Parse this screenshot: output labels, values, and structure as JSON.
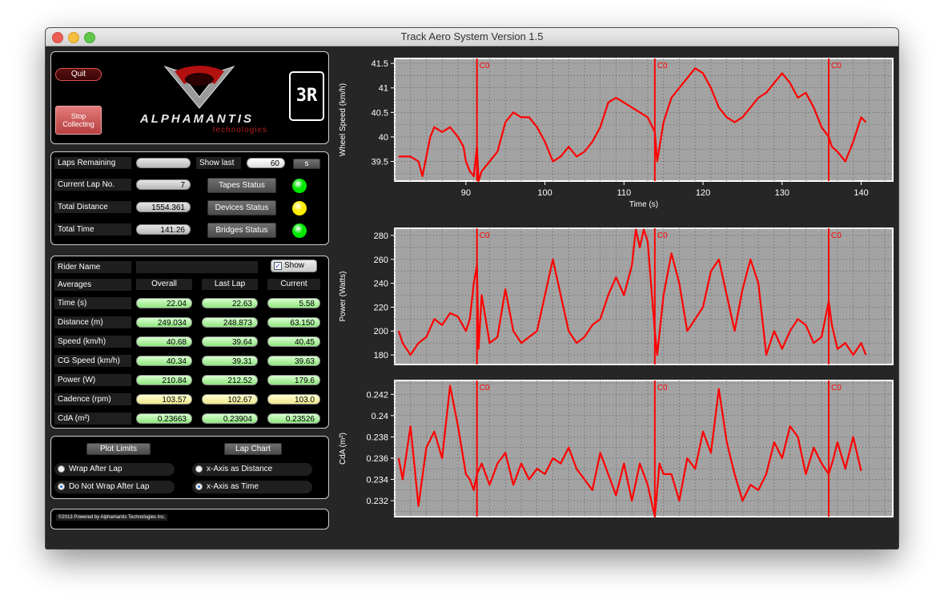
{
  "window": {
    "title": "Track Aero System Version 1.5"
  },
  "header": {
    "quit_label": "Quit",
    "stop_label_1": "Stop",
    "stop_label_2": "Collecting",
    "logo_text": "ALPHAMANTIS",
    "logo_sub": "technologies",
    "track_badge": "3R"
  },
  "status": {
    "laps_remaining_label": "Laps Remaining",
    "laps_remaining_value": "",
    "show_last_label": "Show last",
    "show_last_value": "60",
    "show_last_unit": "s",
    "current_lap_label": "Current Lap No.",
    "current_lap_value": "7",
    "total_distance_label": "Total Distance",
    "total_distance_value": "1554.361",
    "total_time_label": "Total Time",
    "total_time_value": "141.26",
    "tapes_label": "Tapes Status",
    "devices_label": "Devices Status",
    "bridges_label": "Bridges Status",
    "tapes_color": "#00e600",
    "devices_color": "#ffee00",
    "bridges_color": "#00e600"
  },
  "rider": {
    "rider_name_label": "Rider Name",
    "show_label": "Show",
    "averages_label": "Averages",
    "columns": [
      "Overall",
      "Last Lap",
      "Current"
    ],
    "rows": [
      {
        "label": "Time (s)",
        "values": [
          "22.04",
          "22.63",
          "5.58"
        ],
        "style": "green"
      },
      {
        "label": "Distance (m)",
        "values": [
          "249.034",
          "248.873",
          "63.150"
        ],
        "style": "green"
      },
      {
        "label": "Speed (km/h)",
        "values": [
          "40.68",
          "39.64",
          "40.45"
        ],
        "style": "green"
      },
      {
        "label": "CG Speed (km/h)",
        "values": [
          "40.34",
          "39.31",
          "39.63"
        ],
        "style": "green"
      },
      {
        "label": "Power (W)",
        "values": [
          "210.84",
          "212.52",
          "179.6"
        ],
        "style": "green"
      },
      {
        "label": "Cadence (rpm)",
        "values": [
          "103.57",
          "102.67",
          "103.0"
        ],
        "style": "yellow"
      },
      {
        "label": "CdA (m²)",
        "values": [
          "0.23663",
          "0.23904",
          "0.23526"
        ],
        "style": "green"
      }
    ]
  },
  "options": {
    "plot_limits_label": "Plot Limits",
    "lap_chart_label": "Lap Chart",
    "wrap_after_lap": "Wrap After Lap",
    "no_wrap_after_lap": "Do Not Wrap After Lap",
    "x_distance": "x-Axis as Distance",
    "x_time": "x-Axis as Time"
  },
  "footer": {
    "text": "©2013 Powered by Alphamantis Technologies Inc."
  },
  "chart_data": [
    {
      "type": "line",
      "ylabel": "Wheel Speed (km/h)",
      "xlabel": "Time (s)",
      "xlim": [
        81,
        144
      ],
      "ylim": [
        39.1,
        41.6
      ],
      "xticks": [
        90,
        100,
        110,
        120,
        130,
        140
      ],
      "yticks": [
        39.5,
        40,
        40.5,
        41,
        41.5
      ],
      "ytick_labels": [
        "39.5",
        "40",
        "40.5",
        "41",
        "41.5"
      ],
      "marker_label": "C0",
      "markers": [
        91.4,
        113.9,
        135.9
      ],
      "series": [
        {
          "color": "#ff0000",
          "x": [
            81.5,
            83,
            84,
            84.5,
            85.5,
            86,
            87,
            88,
            89,
            89.7,
            90,
            90.5,
            91,
            91.4,
            91.6,
            92,
            93,
            94,
            95,
            96,
            97,
            98,
            99,
            100,
            101,
            102,
            103,
            104,
            105,
            106,
            107,
            108,
            109,
            110,
            111,
            112,
            113,
            113.9,
            114.2,
            115,
            116,
            117,
            118,
            119,
            120,
            121,
            122,
            123,
            124,
            125,
            126,
            127,
            128,
            129,
            130,
            131,
            132,
            133,
            134,
            135,
            135.9,
            136.3,
            137,
            138,
            139,
            140,
            140.6
          ],
          "y": [
            39.6,
            39.6,
            39.5,
            39.2,
            40.0,
            40.2,
            40.1,
            40.2,
            40.0,
            39.8,
            39.5,
            39.3,
            39.2,
            39.8,
            39.1,
            39.3,
            39.5,
            39.7,
            40.3,
            40.5,
            40.4,
            40.4,
            40.2,
            39.9,
            39.5,
            39.6,
            39.8,
            39.6,
            39.7,
            39.9,
            40.2,
            40.7,
            40.8,
            40.7,
            40.6,
            40.5,
            40.4,
            40.1,
            39.5,
            40.3,
            40.8,
            41.0,
            41.2,
            41.4,
            41.3,
            41.0,
            40.6,
            40.4,
            40.3,
            40.4,
            40.6,
            40.8,
            40.9,
            41.1,
            41.3,
            41.1,
            40.8,
            40.9,
            40.6,
            40.2,
            40.0,
            39.8,
            39.7,
            39.5,
            39.9,
            40.4,
            40.3
          ]
        }
      ]
    },
    {
      "type": "line",
      "ylabel": "Power (Watts)",
      "xlabel": "",
      "xlim": [
        81,
        144
      ],
      "ylim": [
        172,
        286
      ],
      "xticks": [],
      "yticks": [
        180,
        200,
        220,
        240,
        260,
        280
      ],
      "ytick_labels": [
        "180",
        "200",
        "220",
        "240",
        "260",
        "280"
      ],
      "marker_label": "C0",
      "markers": [
        91.4,
        113.9,
        135.9
      ],
      "series": [
        {
          "color": "#ff0000",
          "x": [
            81.5,
            82,
            83,
            84,
            85,
            86,
            87,
            88,
            89,
            90,
            90.5,
            91,
            91.4,
            91.6,
            92,
            93,
            94,
            95,
            96,
            97,
            98,
            99,
            100,
            101,
            102,
            103,
            104,
            105,
            106,
            107,
            108,
            109,
            110,
            111,
            111.5,
            112,
            112.5,
            113,
            113.9,
            114.2,
            115,
            116,
            117,
            118,
            119,
            120,
            121,
            122,
            123,
            124,
            125,
            126,
            127,
            128,
            129,
            130,
            131,
            132,
            133,
            134,
            135,
            135.9,
            136.3,
            137,
            138,
            139,
            140,
            140.6
          ],
          "y": [
            200,
            190,
            180,
            190,
            195,
            210,
            205,
            215,
            212,
            200,
            210,
            240,
            255,
            185,
            230,
            190,
            195,
            235,
            200,
            190,
            195,
            200,
            230,
            260,
            230,
            200,
            190,
            195,
            205,
            210,
            230,
            245,
            230,
            255,
            285,
            270,
            285,
            275,
            200,
            180,
            230,
            265,
            240,
            200,
            210,
            220,
            250,
            260,
            230,
            200,
            235,
            260,
            240,
            180,
            200,
            185,
            200,
            210,
            205,
            190,
            195,
            225,
            205,
            185,
            190,
            180,
            190,
            180
          ]
        }
      ]
    },
    {
      "type": "line",
      "ylabel": "CdA (m²)",
      "xlabel": "",
      "xlim": [
        81,
        144
      ],
      "ylim": [
        0.2305,
        0.2433
      ],
      "xticks": [],
      "yticks": [
        0.232,
        0.234,
        0.236,
        0.238,
        0.24,
        0.242
      ],
      "ytick_labels": [
        "0.232",
        "0.234",
        "0.236",
        "0.238",
        "0.24",
        "0.242"
      ],
      "marker_label": "C0",
      "markers": [
        91.4,
        113.9,
        135.9
      ],
      "series": [
        {
          "color": "#ff0000",
          "x": [
            81.5,
            82,
            83,
            84,
            85,
            86,
            87,
            88,
            89,
            90,
            90.5,
            91,
            91.4,
            92,
            93,
            94,
            95,
            96,
            97,
            98,
            99,
            100,
            101,
            102,
            103,
            104,
            105,
            106,
            107,
            108,
            109,
            110,
            111,
            112,
            113,
            113.9,
            114.5,
            115,
            116,
            117,
            118,
            119,
            120,
            121,
            122,
            123,
            124,
            125,
            126,
            127,
            128,
            129,
            130,
            131,
            132,
            133,
            134,
            135,
            135.9,
            136.5,
            137,
            138,
            139,
            140
          ],
          "y": [
            0.236,
            0.234,
            0.239,
            0.2315,
            0.237,
            0.2385,
            0.236,
            0.2428,
            0.239,
            0.2345,
            0.234,
            0.233,
            0.2345,
            0.2355,
            0.2335,
            0.2355,
            0.2365,
            0.2335,
            0.2355,
            0.234,
            0.235,
            0.2345,
            0.236,
            0.2355,
            0.237,
            0.235,
            0.234,
            0.233,
            0.2365,
            0.2345,
            0.2325,
            0.2355,
            0.232,
            0.2355,
            0.2335,
            0.2305,
            0.2355,
            0.2345,
            0.2345,
            0.232,
            0.236,
            0.235,
            0.2385,
            0.2365,
            0.2425,
            0.2375,
            0.2345,
            0.232,
            0.2335,
            0.233,
            0.2345,
            0.2375,
            0.236,
            0.239,
            0.238,
            0.2345,
            0.237,
            0.2355,
            0.2345,
            0.236,
            0.2375,
            0.235,
            0.238,
            0.2348
          ]
        }
      ]
    }
  ]
}
